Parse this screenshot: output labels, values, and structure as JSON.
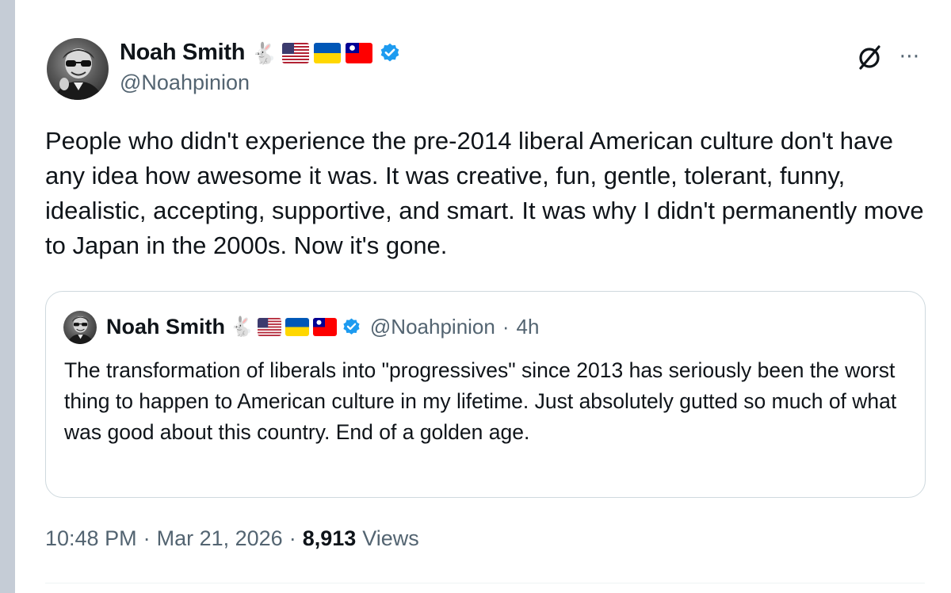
{
  "author": {
    "display_name": "Noah Smith",
    "handle": "@Noahpinion",
    "emoji": "🐇",
    "flags": [
      "us-flag",
      "ukraine-flag",
      "taiwan-flag"
    ],
    "verified": true
  },
  "tweet": {
    "text": "People who didn't experience the pre-2014 liberal American culture don't have any idea how awesome it was. It was creative, fun, gentle, tolerant, funny, idealistic, accepting, supportive, and smart. It was why I didn't permanently move to Japan in the 2000s. Now it's gone.",
    "time": "10:48 PM",
    "date": "Mar 21, 2026",
    "separator": "·",
    "views_count": "8,913",
    "views_label": "Views"
  },
  "quoted_tweet": {
    "display_name": "Noah Smith",
    "handle": "@Noahpinion",
    "separator": "·",
    "age": "4h",
    "text": "The transformation of liberals into \"progressives\" since 2013 has seriously been the worst thing to happen to American culture in my lifetime. Just absolutely gutted so much of what was good about this country. End of a golden age."
  },
  "icons": {
    "more": "⋯",
    "verified_color": "#1d9bf0"
  },
  "colors": {
    "text_primary": "#0f1419",
    "text_secondary": "#536471",
    "border": "#cfd9de"
  }
}
